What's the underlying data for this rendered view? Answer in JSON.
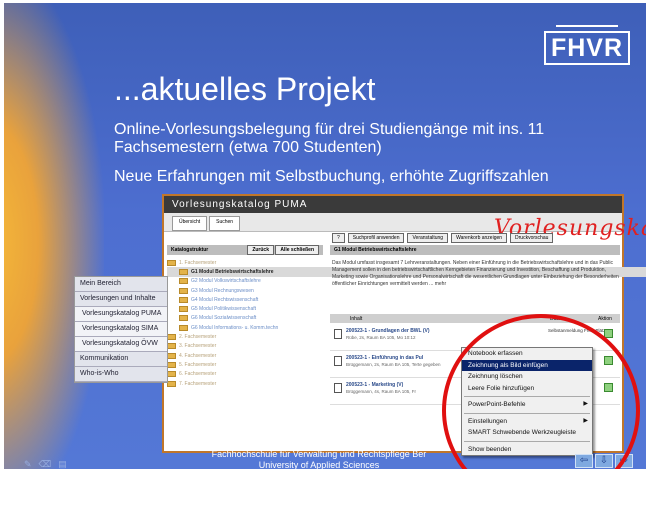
{
  "slide": {
    "logo": "FHVR",
    "title": "...aktuelles Projekt",
    "subtitle1": "Online-Vorlesungsbelegung für drei Studiengänge mit ins. 11 Fachsemestern (etwa 700 Studenten)",
    "subtitle2": "Neue Erfahrungen mit Selbstbuchung, erhöhte Zugriffszahlen",
    "footer_line1": "Fachhochschule für Verwaltung und Rechtspflege Ber",
    "footer_line2": "University of Applied Sciences"
  },
  "catalog": {
    "window_title": "Vorlesungskatalog PUMA",
    "tabs": [
      "Übersicht",
      "Suchen"
    ],
    "toolbar": [
      "Suchprofil anwenden",
      "Veranstaltung",
      "Warenkorb anzeigen",
      "Druckvorschau"
    ],
    "script_title": "Vorlesungskatalog",
    "tree_header": "Katalogstruktur",
    "tree_buttons": [
      "Zurück",
      "Alle schließen"
    ],
    "tree": [
      {
        "label": "1. Fachsemester",
        "level": 0,
        "selected": false
      },
      {
        "label": "G1 Modul Betriebswirtschaftslehre",
        "level": 1,
        "selected": true
      },
      {
        "label": "G2 Modul Volkswirtschaftslehre",
        "level": 1,
        "selected": false
      },
      {
        "label": "G3 Modul Rechnungswesen",
        "level": 1,
        "selected": false
      },
      {
        "label": "G4 Modul Rechtswissenschaft",
        "level": 1,
        "selected": false
      },
      {
        "label": "G5 Modul Politikwissenschaft",
        "level": 1,
        "selected": false
      },
      {
        "label": "G6 Modul Sozialwissenschaft",
        "level": 1,
        "selected": false
      },
      {
        "label": "G6 Modul Informations- u. Komm.techn",
        "level": 1,
        "selected": false
      },
      {
        "label": "2. Fachsemester",
        "level": 0,
        "selected": false
      },
      {
        "label": "3. Fachsemester",
        "level": 0,
        "selected": false
      },
      {
        "label": "4. Fachsemester",
        "level": 0,
        "selected": false
      },
      {
        "label": "5. Fachsemester",
        "level": 0,
        "selected": false
      },
      {
        "label": "6. Fachsemester",
        "level": 0,
        "selected": false
      },
      {
        "label": "7. Fachsemester",
        "level": 0,
        "selected": false
      }
    ],
    "detail_header": "G1 Modul Betriebswirtschaftslehre",
    "detail_text": "Das Modul umfasst insgesamt 7 Lehrveranstaltungen. Neben einer Einführung in die Betriebswirtschaftslehre und in das Public Management sollen in den betriebswirtschaftlichen Kerngebieten Finanzierung und Investition, Beschaffung und Produktion, Marketing sowie Organisationslehre und Personalwirtschaft die wesentlichen Grundlagen unter Einbeziehung der Besonderheiten öffentlicher Einrichtungen vermittelt werden ... mehr",
    "table_cols": [
      "Inhalt",
      "Daten",
      "Aktion"
    ],
    "rows": [
      {
        "title": "200523-1 - Grundlagen der BWL (V)",
        "meta": "Rübe, 2s, Raum BA 105, Mo 10:12",
        "date": "Selbstanmeldung Freie Plätze: 7"
      },
      {
        "title": "200523-1 - Einführung in das Pul",
        "meta": "Brüggemann, 2s, Raum BA 105, Terte gegeben",
        "date": ""
      },
      {
        "title": "200523-1 - Marketing (V)",
        "meta": "Brüggemann, 4s, Raum BA 105, Fr",
        "date": ""
      }
    ]
  },
  "leftnav": [
    {
      "label": "Mein Bereich",
      "sub": false
    },
    {
      "label": "Vorlesungen und Inhalte",
      "sub": false
    },
    {
      "label": "Vorlesungskatalog PUMA",
      "sub": true
    },
    {
      "label": "Vorlesungskatalog SIMA",
      "sub": true
    },
    {
      "label": "Vorlesungskatalog ÖVW",
      "sub": true
    },
    {
      "label": "Kommunikation",
      "sub": false
    },
    {
      "label": "Who-is-Who",
      "sub": false
    }
  ],
  "context_menu": [
    {
      "label": "Notebook erfassen",
      "sub": false,
      "selected": false
    },
    {
      "label": "Zeichnung als Bild einfügen",
      "sub": false,
      "selected": true
    },
    {
      "label": "Zeichnung löschen",
      "sub": false,
      "selected": false
    },
    {
      "label": "Leere Folie hinzufügen",
      "sub": false,
      "selected": false
    },
    {
      "sep": true
    },
    {
      "label": "PowerPoint-Befehle",
      "sub": true,
      "selected": false
    },
    {
      "sep": true
    },
    {
      "label": "Einstellungen",
      "sub": true,
      "selected": false
    },
    {
      "label": "SMART Schwebende Werkzeugleiste",
      "sub": false,
      "selected": false
    },
    {
      "sep": true
    },
    {
      "label": "Show beenden",
      "sub": false,
      "selected": false
    }
  ],
  "colors": {
    "slide_bg": "#4d6ed0",
    "highlight_ring": "#e01010",
    "menu_selected": "#0a246a"
  }
}
